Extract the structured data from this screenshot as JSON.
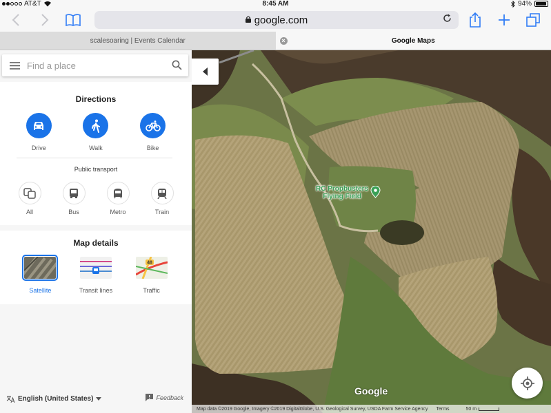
{
  "status_bar": {
    "carrier": "AT&T",
    "time": "8:45 AM",
    "battery": "94%",
    "battery_level": 0.94
  },
  "toolbar": {
    "url": "google.com",
    "icons": [
      "back-icon",
      "forward-icon",
      "bookmarks-icon",
      "lock-icon",
      "reload-icon",
      "share-icon",
      "new-tab-icon",
      "tabs-icon"
    ]
  },
  "tabs": [
    {
      "title": "scalesoaring | Events Calendar",
      "active": false
    },
    {
      "title": "Google Maps",
      "active": true
    }
  ],
  "search": {
    "placeholder": "Find a place"
  },
  "directions": {
    "title": "Directions",
    "modes": [
      {
        "label": "Drive",
        "icon": "car-icon"
      },
      {
        "label": "Walk",
        "icon": "walk-icon"
      },
      {
        "label": "Bike",
        "icon": "bike-icon"
      }
    ],
    "public_transport_title": "Public transport",
    "transit_modes": [
      {
        "label": "All",
        "icon": "all-transit-icon"
      },
      {
        "label": "Bus",
        "icon": "bus-icon"
      },
      {
        "label": "Metro",
        "icon": "metro-icon"
      },
      {
        "label": "Train",
        "icon": "train-icon"
      }
    ]
  },
  "map_details": {
    "title": "Map details",
    "options": [
      {
        "label": "Satellite",
        "selected": true
      },
      {
        "label": "Transit lines",
        "selected": false
      },
      {
        "label": "Traffic",
        "selected": false,
        "badge": "48"
      }
    ]
  },
  "footer": {
    "language": "English (United States)",
    "feedback": "Feedback"
  },
  "map": {
    "place_label_line1": "RC Propbusters",
    "place_label_line2": "Flying Field",
    "logo": "Google",
    "attribution": "Map data ©2019 Google, Imagery ©2019 DigitalGlobe, U.S. Geological Survey, USDA Farm Service Agency",
    "terms": "Terms",
    "scale": "50 m"
  },
  "colors": {
    "accent": "#1a73e8",
    "ios_blue": "#2f7cf6",
    "pin_green": "#3aa055"
  }
}
